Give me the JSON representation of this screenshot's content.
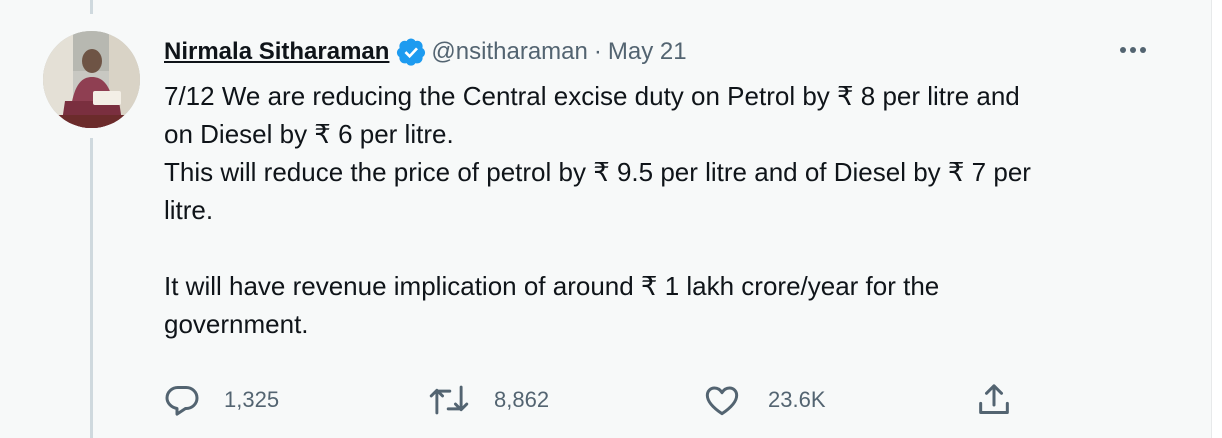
{
  "tweet": {
    "author_name": "Nirmala Sitharaman",
    "handle": "@nsitharaman",
    "separator": "·",
    "date": "May 21",
    "text": "7/12 We are reducing the Central excise duty on Petrol by ₹ 8 per litre and\non Diesel by ₹ 6 per litre.\nThis will reduce the price of petrol by ₹ 9.5 per litre and of Diesel by ₹ 7 per\nlitre.\n\nIt will have revenue implication of around ₹ 1 lakh crore/year for the\ngovernment.",
    "verified": true
  },
  "actions": {
    "reply_count": "1,325",
    "retweet_count": "8,862",
    "like_count": "23.6K"
  },
  "icons": {
    "verified": "verified-badge-icon",
    "more": "more-icon",
    "reply": "reply-icon",
    "retweet": "retweet-icon",
    "like": "like-icon",
    "share": "share-icon"
  },
  "colors": {
    "verified": "#1d9bf0",
    "secondary_text": "#536471",
    "primary_text": "#0f1419",
    "background": "#f7f9f9",
    "thread_line": "#cfd9de"
  }
}
